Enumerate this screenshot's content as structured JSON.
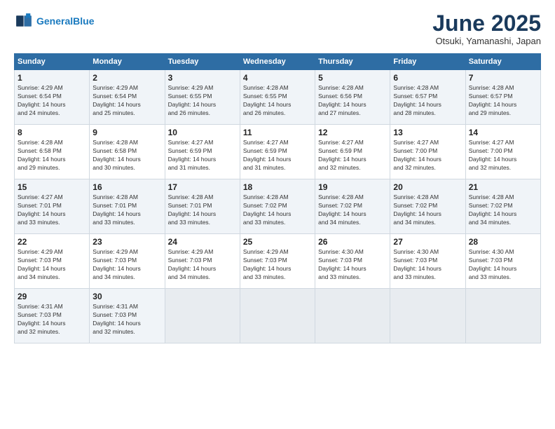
{
  "logo": {
    "line1": "General",
    "line2": "Blue"
  },
  "title": "June 2025",
  "subtitle": "Otsuki, Yamanashi, Japan",
  "weekdays": [
    "Sunday",
    "Monday",
    "Tuesday",
    "Wednesday",
    "Thursday",
    "Friday",
    "Saturday"
  ],
  "rows": [
    [
      {
        "day": "1",
        "rise": "Sunrise: 4:29 AM",
        "set": "Sunset: 6:54 PM",
        "daylight": "Daylight: 14 hours",
        "minutes": "and 24 minutes."
      },
      {
        "day": "2",
        "rise": "Sunrise: 4:29 AM",
        "set": "Sunset: 6:54 PM",
        "daylight": "Daylight: 14 hours",
        "minutes": "and 25 minutes."
      },
      {
        "day": "3",
        "rise": "Sunrise: 4:29 AM",
        "set": "Sunset: 6:55 PM",
        "daylight": "Daylight: 14 hours",
        "minutes": "and 26 minutes."
      },
      {
        "day": "4",
        "rise": "Sunrise: 4:28 AM",
        "set": "Sunset: 6:55 PM",
        "daylight": "Daylight: 14 hours",
        "minutes": "and 26 minutes."
      },
      {
        "day": "5",
        "rise": "Sunrise: 4:28 AM",
        "set": "Sunset: 6:56 PM",
        "daylight": "Daylight: 14 hours",
        "minutes": "and 27 minutes."
      },
      {
        "day": "6",
        "rise": "Sunrise: 4:28 AM",
        "set": "Sunset: 6:57 PM",
        "daylight": "Daylight: 14 hours",
        "minutes": "and 28 minutes."
      },
      {
        "day": "7",
        "rise": "Sunrise: 4:28 AM",
        "set": "Sunset: 6:57 PM",
        "daylight": "Daylight: 14 hours",
        "minutes": "and 29 minutes."
      }
    ],
    [
      {
        "day": "8",
        "rise": "Sunrise: 4:28 AM",
        "set": "Sunset: 6:58 PM",
        "daylight": "Daylight: 14 hours",
        "minutes": "and 29 minutes."
      },
      {
        "day": "9",
        "rise": "Sunrise: 4:28 AM",
        "set": "Sunset: 6:58 PM",
        "daylight": "Daylight: 14 hours",
        "minutes": "and 30 minutes."
      },
      {
        "day": "10",
        "rise": "Sunrise: 4:27 AM",
        "set": "Sunset: 6:59 PM",
        "daylight": "Daylight: 14 hours",
        "minutes": "and 31 minutes."
      },
      {
        "day": "11",
        "rise": "Sunrise: 4:27 AM",
        "set": "Sunset: 6:59 PM",
        "daylight": "Daylight: 14 hours",
        "minutes": "and 31 minutes."
      },
      {
        "day": "12",
        "rise": "Sunrise: 4:27 AM",
        "set": "Sunset: 6:59 PM",
        "daylight": "Daylight: 14 hours",
        "minutes": "and 32 minutes."
      },
      {
        "day": "13",
        "rise": "Sunrise: 4:27 AM",
        "set": "Sunset: 7:00 PM",
        "daylight": "Daylight: 14 hours",
        "minutes": "and 32 minutes."
      },
      {
        "day": "14",
        "rise": "Sunrise: 4:27 AM",
        "set": "Sunset: 7:00 PM",
        "daylight": "Daylight: 14 hours",
        "minutes": "and 32 minutes."
      }
    ],
    [
      {
        "day": "15",
        "rise": "Sunrise: 4:27 AM",
        "set": "Sunset: 7:01 PM",
        "daylight": "Daylight: 14 hours",
        "minutes": "and 33 minutes."
      },
      {
        "day": "16",
        "rise": "Sunrise: 4:28 AM",
        "set": "Sunset: 7:01 PM",
        "daylight": "Daylight: 14 hours",
        "minutes": "and 33 minutes."
      },
      {
        "day": "17",
        "rise": "Sunrise: 4:28 AM",
        "set": "Sunset: 7:01 PM",
        "daylight": "Daylight: 14 hours",
        "minutes": "and 33 minutes."
      },
      {
        "day": "18",
        "rise": "Sunrise: 4:28 AM",
        "set": "Sunset: 7:02 PM",
        "daylight": "Daylight: 14 hours",
        "minutes": "and 33 minutes."
      },
      {
        "day": "19",
        "rise": "Sunrise: 4:28 AM",
        "set": "Sunset: 7:02 PM",
        "daylight": "Daylight: 14 hours",
        "minutes": "and 34 minutes."
      },
      {
        "day": "20",
        "rise": "Sunrise: 4:28 AM",
        "set": "Sunset: 7:02 PM",
        "daylight": "Daylight: 14 hours",
        "minutes": "and 34 minutes."
      },
      {
        "day": "21",
        "rise": "Sunrise: 4:28 AM",
        "set": "Sunset: 7:02 PM",
        "daylight": "Daylight: 14 hours",
        "minutes": "and 34 minutes."
      }
    ],
    [
      {
        "day": "22",
        "rise": "Sunrise: 4:29 AM",
        "set": "Sunset: 7:03 PM",
        "daylight": "Daylight: 14 hours",
        "minutes": "and 34 minutes."
      },
      {
        "day": "23",
        "rise": "Sunrise: 4:29 AM",
        "set": "Sunset: 7:03 PM",
        "daylight": "Daylight: 14 hours",
        "minutes": "and 34 minutes."
      },
      {
        "day": "24",
        "rise": "Sunrise: 4:29 AM",
        "set": "Sunset: 7:03 PM",
        "daylight": "Daylight: 14 hours",
        "minutes": "and 34 minutes."
      },
      {
        "day": "25",
        "rise": "Sunrise: 4:29 AM",
        "set": "Sunset: 7:03 PM",
        "daylight": "Daylight: 14 hours",
        "minutes": "and 33 minutes."
      },
      {
        "day": "26",
        "rise": "Sunrise: 4:30 AM",
        "set": "Sunset: 7:03 PM",
        "daylight": "Daylight: 14 hours",
        "minutes": "and 33 minutes."
      },
      {
        "day": "27",
        "rise": "Sunrise: 4:30 AM",
        "set": "Sunset: 7:03 PM",
        "daylight": "Daylight: 14 hours",
        "minutes": "and 33 minutes."
      },
      {
        "day": "28",
        "rise": "Sunrise: 4:30 AM",
        "set": "Sunset: 7:03 PM",
        "daylight": "Daylight: 14 hours",
        "minutes": "and 33 minutes."
      }
    ],
    [
      {
        "day": "29",
        "rise": "Sunrise: 4:31 AM",
        "set": "Sunset: 7:03 PM",
        "daylight": "Daylight: 14 hours",
        "minutes": "and 32 minutes."
      },
      {
        "day": "30",
        "rise": "Sunrise: 4:31 AM",
        "set": "Sunset: 7:03 PM",
        "daylight": "Daylight: 14 hours",
        "minutes": "and 32 minutes."
      },
      null,
      null,
      null,
      null,
      null
    ]
  ]
}
